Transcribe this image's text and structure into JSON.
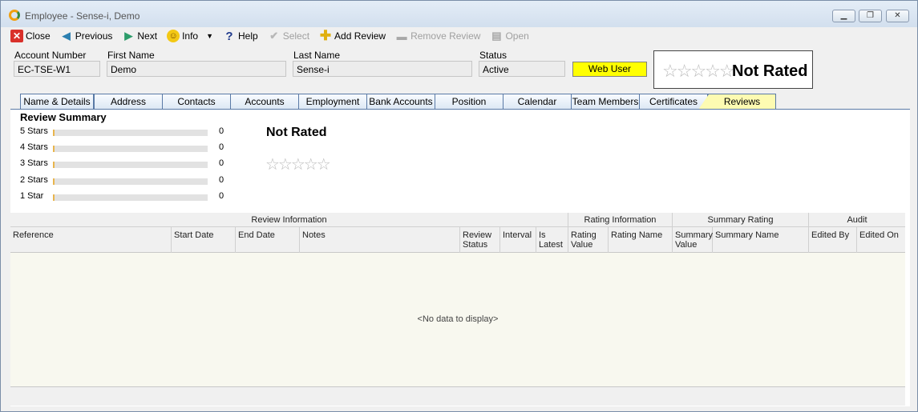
{
  "window": {
    "title": "Employee - Sense-i, Demo"
  },
  "toolbar": {
    "close": "Close",
    "previous": "Previous",
    "next": "Next",
    "info": "Info",
    "help": "Help",
    "select": "Select",
    "add_review": "Add Review",
    "remove_review": "Remove Review",
    "open": "Open"
  },
  "header": {
    "account_number_label": "Account Number",
    "account_number": "EC-TSE-W1",
    "first_name_label": "First Name",
    "first_name": "Demo",
    "last_name_label": "Last Name",
    "last_name": "Sense-i",
    "status_label": "Status",
    "status": "Active",
    "web_user": "Web User",
    "rating_text": "Not Rated",
    "rating_stars": 0
  },
  "tabs": [
    "Name & Details",
    "Address",
    "Contacts",
    "Accounts",
    "Employment",
    "Bank Accounts",
    "Position",
    "Calendar",
    "Team Members",
    "Certificates",
    "Reviews"
  ],
  "active_tab": "Reviews",
  "review_summary": {
    "title": "Review Summary",
    "rows": [
      {
        "label": "5 Stars",
        "count": "0"
      },
      {
        "label": "4 Stars",
        "count": "0"
      },
      {
        "label": "3 Stars",
        "count": "0"
      },
      {
        "label": "2 Stars",
        "count": "0"
      },
      {
        "label": "1 Star",
        "count": "0"
      }
    ],
    "overall": "Not Rated",
    "overall_stars": 0
  },
  "grid": {
    "bands": [
      "Review Information",
      "Rating Information",
      "Summary Rating",
      "Audit"
    ],
    "columns": [
      "Reference",
      "Start Date",
      "End Date",
      "Notes",
      "Review Status",
      "Interval",
      "Is Latest",
      "Rating Value",
      "Rating Name",
      "Summary Value",
      "Summary Name",
      "Edited By",
      "Edited On"
    ],
    "empty_text": "<No data to display>"
  },
  "colors": {
    "web_user_bg": "#ffff00",
    "active_tab_bg": "#fdfbb2"
  }
}
